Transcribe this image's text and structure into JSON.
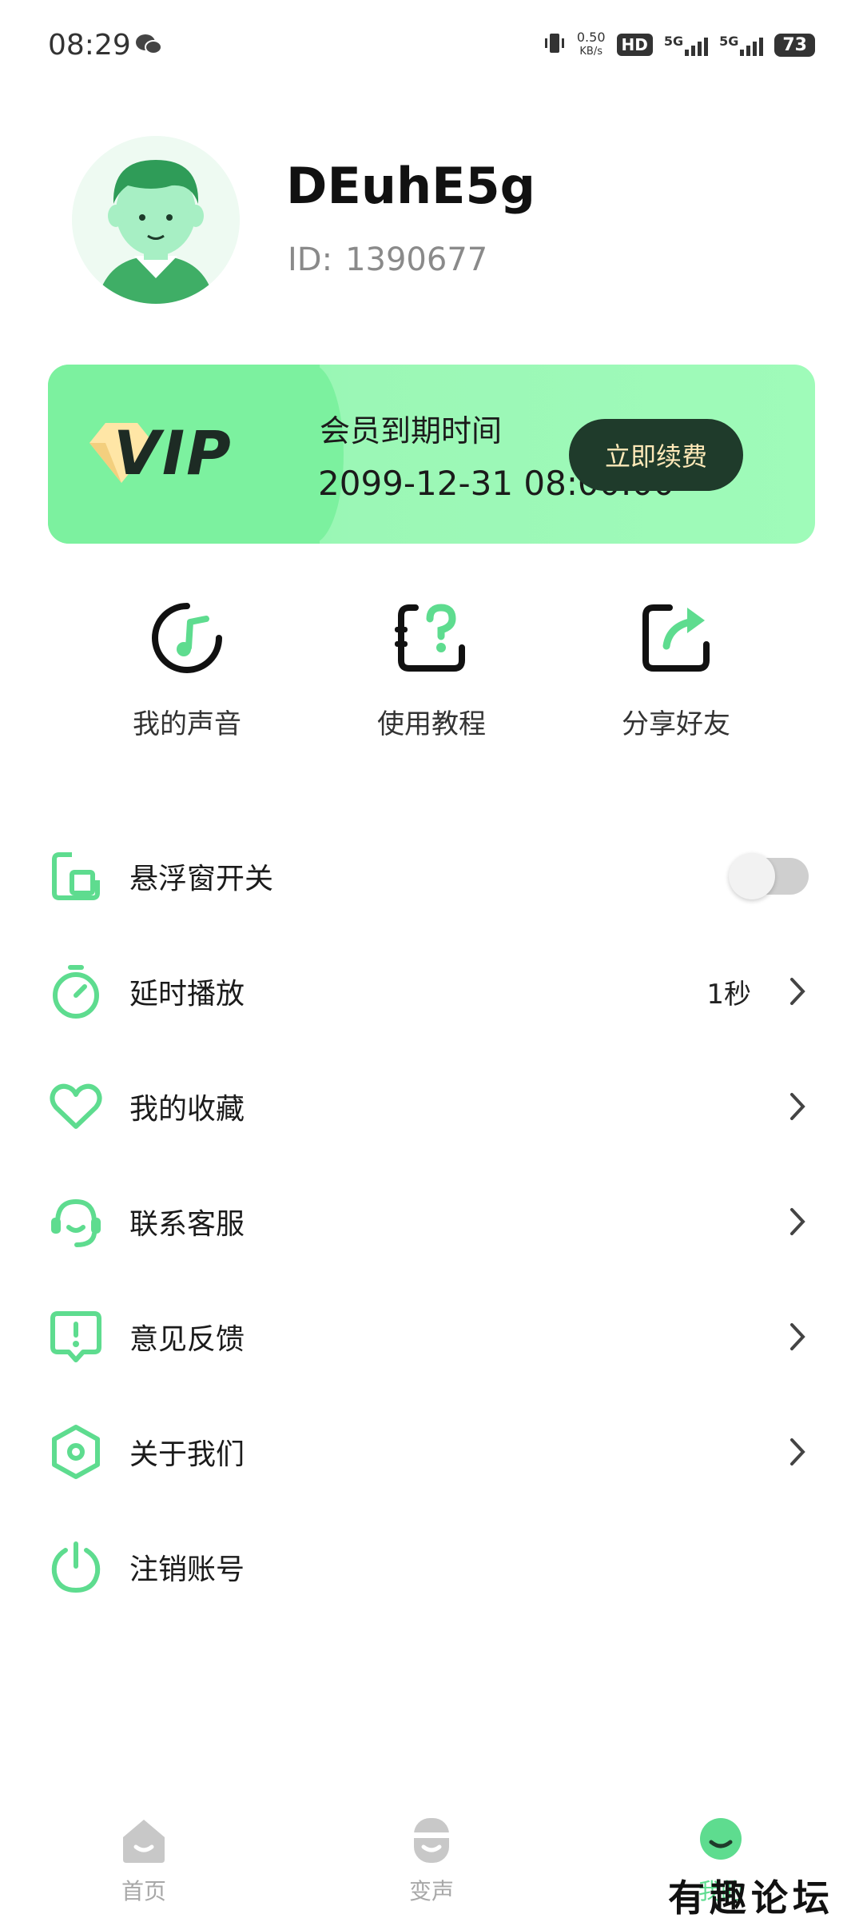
{
  "status_bar": {
    "time": "08:29",
    "net_speed_value": "0.50",
    "net_speed_unit": "KB/s",
    "hd_label": "HD",
    "sim1_label": "5G",
    "sim2_label": "5G",
    "battery": "73"
  },
  "profile": {
    "username": "DEuhE5g",
    "id_label": "ID:",
    "id_value": "1390677"
  },
  "vip": {
    "logo_text": "VIP",
    "title": "会员到期时间",
    "expiry": "2099-12-31 08:00:00",
    "renew_button": "立即续费"
  },
  "quick_actions": [
    {
      "label": "我的声音",
      "icon": "music-note-icon"
    },
    {
      "label": "使用教程",
      "icon": "tutorial-help-icon"
    },
    {
      "label": "分享好友",
      "icon": "share-arrow-icon"
    }
  ],
  "menu": [
    {
      "label": "悬浮窗开关",
      "icon": "floating-window-icon",
      "toggle": false
    },
    {
      "label": "延时播放",
      "icon": "timer-icon",
      "value": "1秒"
    },
    {
      "label": "我的收藏",
      "icon": "heart-icon"
    },
    {
      "label": "联系客服",
      "icon": "headset-icon"
    },
    {
      "label": "意见反馈",
      "icon": "feedback-icon"
    },
    {
      "label": "关于我们",
      "icon": "hexagon-about-icon"
    },
    {
      "label": "注销账号",
      "icon": "power-icon"
    }
  ],
  "bottom_nav": [
    {
      "label": "首页",
      "icon": "home-icon"
    },
    {
      "label": "变声",
      "icon": "voice-change-icon"
    },
    {
      "label": "我的",
      "icon": "profile-face-icon",
      "active": true
    }
  ],
  "watermark": "有趣论坛",
  "colors": {
    "accent_green": "#5edc8f",
    "vip_card": "#8ff7b0",
    "renew_button_bg": "#1f3b2b",
    "renew_button_text": "#ffe9b8"
  }
}
